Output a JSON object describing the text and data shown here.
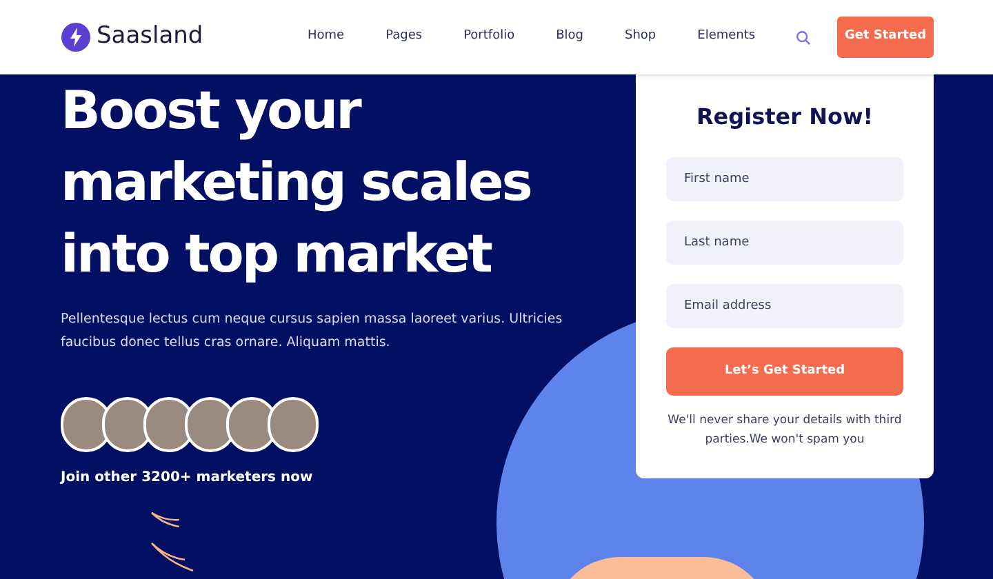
{
  "header": {
    "logo": "Saasland",
    "nav": [
      "Home",
      "Pages",
      "Portfolio",
      "Blog",
      "Shop",
      "Elements"
    ],
    "cta": "Get Started"
  },
  "hero": {
    "headline": [
      "Boost your",
      "marketing scales",
      "into top market"
    ],
    "description": "Pellentesque lectus cum neque cursus sapien massa laoreet varius. Ultricies faucibus donec tellus cras ornare. Aliquam mattis.",
    "join_text": "Join other 3200+ marketers now"
  },
  "register": {
    "title": "Register Now!",
    "fields": [
      {
        "placeholder": "First name"
      },
      {
        "placeholder": "Last name"
      },
      {
        "placeholder": "Email address"
      }
    ],
    "submit": "Let’s Get Started",
    "note": "We'll never share your details with third parties.We won't spam you"
  }
}
